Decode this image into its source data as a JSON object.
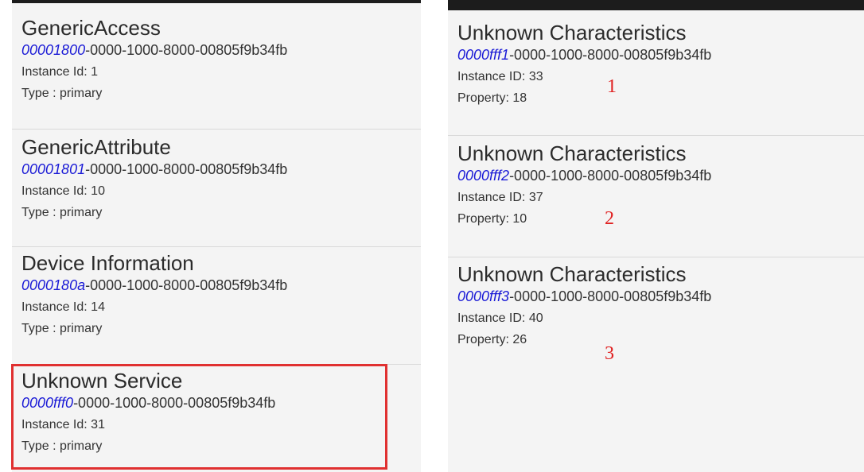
{
  "left": {
    "services": [
      {
        "name": "GenericAccess",
        "uuid_short": "00001800",
        "uuid_rest": "-0000-1000-8000-00805f9b34fb",
        "instance": "Instance Id: 1",
        "type": "Type : primary"
      },
      {
        "name": "GenericAttribute",
        "uuid_short": "00001801",
        "uuid_rest": "-0000-1000-8000-00805f9b34fb",
        "instance": "Instance Id: 10",
        "type": "Type : primary"
      },
      {
        "name": "Device Information",
        "uuid_short": "0000180a",
        "uuid_rest": "-0000-1000-8000-00805f9b34fb",
        "instance": "Instance Id: 14",
        "type": "Type : primary"
      },
      {
        "name": "Unknown Service",
        "uuid_short": "0000fff0",
        "uuid_rest": "-0000-1000-8000-00805f9b34fb",
        "instance": "Instance Id: 31",
        "type": "Type : primary"
      }
    ]
  },
  "right": {
    "characteristics": [
      {
        "name": "Unknown Characteristics",
        "uuid_short": "0000fff1",
        "uuid_rest": "-0000-1000-8000-00805f9b34fb",
        "instance": "Instance ID: 33",
        "property": "Property: 18",
        "annotation": "1"
      },
      {
        "name": "Unknown Characteristics",
        "uuid_short": "0000fff2",
        "uuid_rest": "-0000-1000-8000-00805f9b34fb",
        "instance": "Instance ID: 37",
        "property": "Property: 10",
        "annotation": "2"
      },
      {
        "name": "Unknown Characteristics",
        "uuid_short": "0000fff3",
        "uuid_rest": "-0000-1000-8000-00805f9b34fb",
        "instance": "Instance ID: 40",
        "property": "Property: 26",
        "annotation": "3"
      }
    ]
  },
  "colors": {
    "uuid_accent": "#1a1ad6",
    "highlight_border": "#e03030",
    "annotation": "#e02020"
  }
}
